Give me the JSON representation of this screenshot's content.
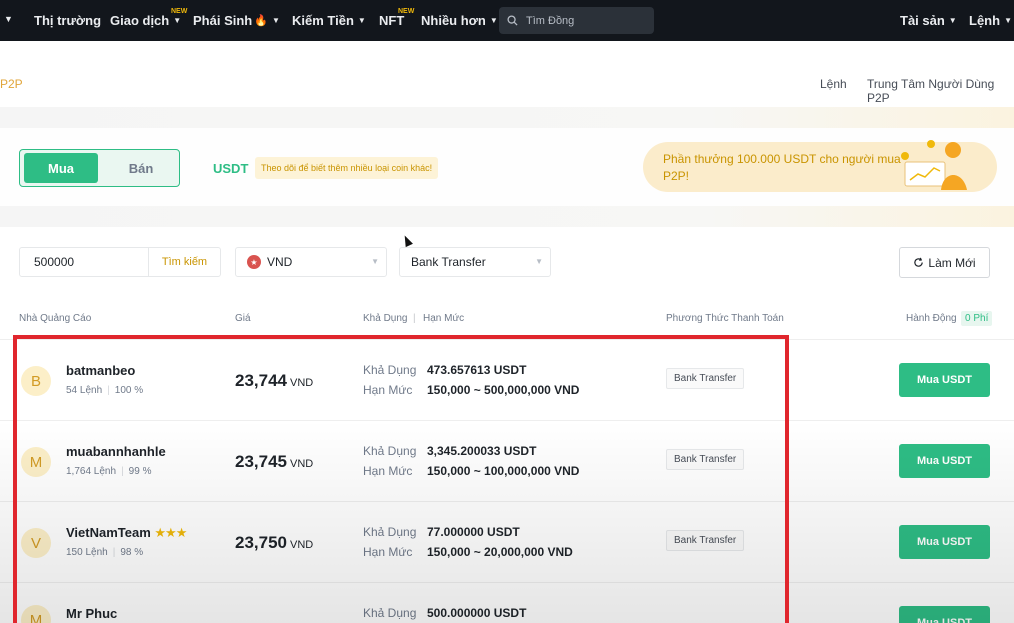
{
  "nav": {
    "items": [
      {
        "label": "Thị trường",
        "caret": false,
        "new": false
      },
      {
        "label": "Giao dịch",
        "caret": true,
        "new": true
      },
      {
        "label": "Phái Sinh",
        "caret": true,
        "new": false,
        "flame": true
      },
      {
        "label": "Kiếm Tiền",
        "caret": true,
        "new": false
      },
      {
        "label": "NFT",
        "caret": false,
        "new": true
      },
      {
        "label": "Nhiều hơn",
        "caret": true,
        "new": false
      }
    ],
    "new_badge": "NEW",
    "search_placeholder": "Tìm Đồng",
    "assets_label": "Tài sản",
    "orders_label": "Lệnh"
  },
  "subheader": {
    "tab": "P2P",
    "links": [
      "Lệnh",
      "Trung Tâm Người Dùng P2P"
    ]
  },
  "trade": {
    "buy_label": "Mua",
    "sell_label": "Bán",
    "asset": "USDT",
    "asset_hint": "Theo dõi để biết thêm nhiều loại coin khác!",
    "promo_text": "Phần thưởng 100.000 USDT cho người mua P2P!"
  },
  "filters": {
    "amount_value": "500000",
    "search_label": "Tìm kiếm",
    "fiat": "VND",
    "payment": "Bank Transfer",
    "refresh_label": "Làm Mới"
  },
  "table": {
    "headers": {
      "advertiser": "Nhà Quảng Cáo",
      "price": "Giá",
      "available": "Khả Dụng",
      "limit": "Hạn Mức",
      "payment": "Phương Thức Thanh Toán",
      "action": "Hành Động",
      "fee": "0 Phí"
    },
    "rows": [
      {
        "initial": "B",
        "name": "batmanbeo",
        "stars": "",
        "orders": "54 Lệnh",
        "completion": "100 %",
        "price": "23,744",
        "currency": "VND",
        "available_label": "Khả Dụng",
        "available": "473.657613 USDT",
        "limit_label": "Hạn Mức",
        "limit": "150,000 ~ 500,000,000 VND",
        "payment": "Bank Transfer",
        "button": "Mua USDT"
      },
      {
        "initial": "M",
        "name": "muabannhanhle",
        "stars": "",
        "orders": "1,764 Lệnh",
        "completion": "99 %",
        "price": "23,745",
        "currency": "VND",
        "available_label": "Khả Dụng",
        "available": "3,345.200033 USDT",
        "limit_label": "Hạn Mức",
        "limit": "150,000 ~ 100,000,000 VND",
        "payment": "Bank Transfer",
        "button": "Mua USDT"
      },
      {
        "initial": "V",
        "name": "VietNamTeam",
        "stars": "★★★",
        "orders": "150 Lệnh",
        "completion": "98 %",
        "price": "23,750",
        "currency": "VND",
        "available_label": "Khả Dụng",
        "available": "77.000000 USDT",
        "limit_label": "Hạn Mức",
        "limit": "150,000 ~ 20,000,000 VND",
        "payment": "Bank Transfer",
        "button": "Mua USDT"
      },
      {
        "initial": "M",
        "name": "Mr Phuc",
        "stars": "",
        "orders": "",
        "completion": "",
        "price": "",
        "currency": "",
        "available_label": "Khả Dụng",
        "available": "500.000000 USDT",
        "limit_label": "",
        "limit": "",
        "payment": "",
        "button": "Mua USDT"
      }
    ]
  },
  "colors": {
    "accent_green": "#2ebd85",
    "brand_yellow": "#f0b90b",
    "highlight_red": "#e0262d",
    "nav_bg": "#12161c"
  }
}
